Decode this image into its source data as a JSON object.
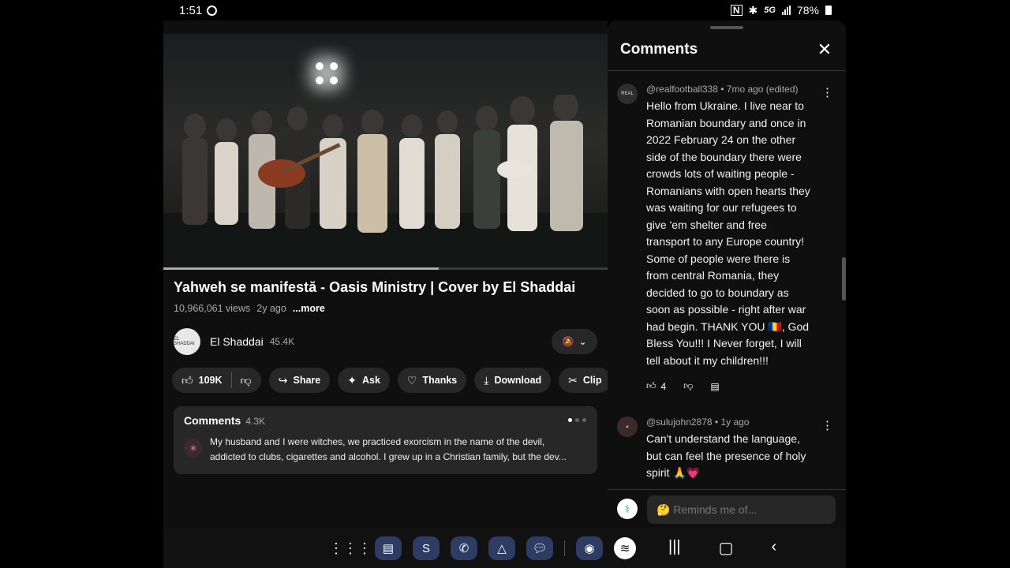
{
  "status": {
    "time": "1:51",
    "network": "5G",
    "battery": "78%"
  },
  "video": {
    "title": "Yahweh se manifestă - Oasis Ministry | Cover by El Shaddai",
    "views": "10,966,061 views",
    "age": "2y ago",
    "more": "...more",
    "progress_fraction": 0.62
  },
  "channel": {
    "name": "El Shaddai",
    "subscribers": "45.4K"
  },
  "actions": {
    "likes": "109K",
    "share": "Share",
    "ask": "Ask",
    "thanks": "Thanks",
    "download": "Download",
    "clip": "Clip"
  },
  "comments_card": {
    "title": "Comments",
    "count": "4.3K",
    "line1": "My husband and I were witches, we practiced exorcism in the name of the devil,",
    "line2": "addicted to clubs, cigarettes and alcohol. I grew up in a Christian family, but the dev..."
  },
  "panel": {
    "title": "Comments",
    "input_placeholder": "🤔 Reminds me of...",
    "comments": [
      {
        "meta": "@realfootball338 • 7mo ago (edited)",
        "lines": [
          "Hello from Ukraine. I live near to",
          "Romanian boundary and once in",
          "2022 February 24 on the other",
          "side of the boundary there were",
          "crowds lots of waiting people -",
          "Romanians with open hearts they",
          "was waiting for our refugees to",
          "give 'em shelter and free",
          "transport to any Europe country!",
          "Some of people were there is",
          "from central Romania, they",
          "decided to go to boundary as",
          "soon as possible - right after war",
          "had begin. THANK YOU 🇷🇴, God",
          "Bless You!!! I Never forget, I will",
          "tell about it my children!!!"
        ],
        "likes": "4"
      },
      {
        "meta": "@sulujohn2878 • 1y ago",
        "lines": [
          "Can't understand the language,",
          "but can feel the presence of holy",
          "spirit 🙏💗"
        ]
      }
    ]
  }
}
